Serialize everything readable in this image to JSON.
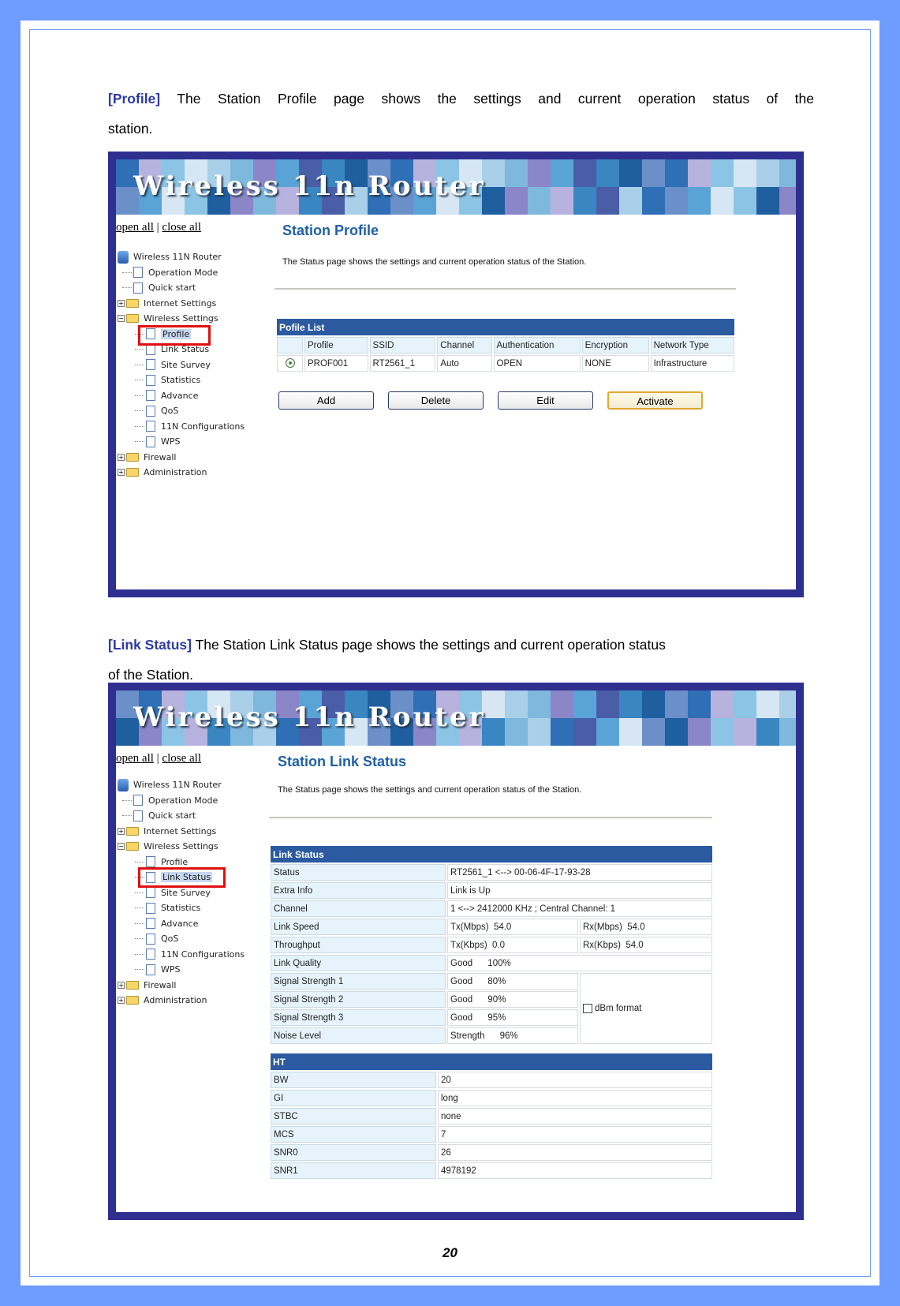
{
  "page": {
    "profile_para": {
      "keyword": "[Profile]",
      "text": " The Station Profile page shows the settings and current operation status of the",
      "text2": "station."
    },
    "link_para": {
      "keyword": "[Link Status]",
      "text": " The Station Link Status page shows the settings and current operation status",
      "text2": "of the Station."
    },
    "page_number": "20",
    "border_color": "#6f9cff",
    "frame_color": "#2f2f8f"
  },
  "common": {
    "banner_title": "Wireless 11n Router",
    "open_all": "open all",
    "separator": "|",
    "close_all": "close all",
    "tree": [
      {
        "label": "Wireless 11N Router",
        "type": "root"
      },
      {
        "label": "Operation Mode",
        "type": "page",
        "level": 1
      },
      {
        "label": "Quick start",
        "type": "page",
        "level": 1
      },
      {
        "label": "Internet Settings",
        "type": "folder-collapsed",
        "level": 1
      },
      {
        "label": "Wireless Settings",
        "type": "folder-expanded",
        "level": 1
      },
      {
        "label": "Profile",
        "type": "page",
        "level": 2
      },
      {
        "label": "Link Status",
        "type": "page",
        "level": 2
      },
      {
        "label": "Site Survey",
        "type": "page",
        "level": 2
      },
      {
        "label": "Statistics",
        "type": "page",
        "level": 2
      },
      {
        "label": "Advance",
        "type": "page",
        "level": 2
      },
      {
        "label": "QoS",
        "type": "page",
        "level": 2
      },
      {
        "label": "11N Configurations",
        "type": "page",
        "level": 2
      },
      {
        "label": "WPS",
        "type": "page",
        "level": 2
      },
      {
        "label": "Firewall",
        "type": "folder-collapsed",
        "level": 1
      },
      {
        "label": "Administration",
        "type": "folder-collapsed",
        "level": 1
      }
    ],
    "highlight_color": "#e01010",
    "header_color": "#2b5aa0"
  },
  "profile_shot": {
    "selected_item": "Profile",
    "title": "Station Profile",
    "description": "The Status page shows the settings and current operation status of the Station.",
    "list_title": "Pofile List",
    "columns": [
      "",
      "Profile",
      "SSID",
      "Channel",
      "Authentication",
      "Encryption",
      "Network Type"
    ],
    "rows": [
      {
        "selected": true,
        "profile": "PROF001",
        "ssid": "RT2561_1",
        "channel": "Auto",
        "auth": "OPEN",
        "enc": "NONE",
        "type": "Infrastructure"
      }
    ],
    "buttons": {
      "add": "Add",
      "delete": "Delete",
      "edit": "Edit",
      "activate": "Activate"
    }
  },
  "link_shot": {
    "selected_item": "Link Status",
    "title": "Station Link Status",
    "description": "The Status page shows the settings and current operation status of the Station.",
    "link_title": "Link Status",
    "status": {
      "label": "Status",
      "value": "RT2561_1 <--> 00-06-4F-17-93-28"
    },
    "extra": {
      "label": "Extra Info",
      "value": "Link is Up"
    },
    "channel": {
      "label": "Channel",
      "value": "1 <--> 2412000 KHz ; Central Channel: 1"
    },
    "speed": {
      "label": "Link Speed",
      "tx": "Tx(Mbps)  54.0",
      "rx": "Rx(Mbps)  54.0"
    },
    "throughput": {
      "label": "Throughput",
      "tx": "Tx(Kbps)  0.0",
      "rx": "Rx(Kbps)  54.0"
    },
    "quality": {
      "label": "Link Quality",
      "value": "Good      100%"
    },
    "signal1": {
      "label": "Signal Strength 1",
      "value": "Good      80%"
    },
    "signal2": {
      "label": "Signal Strength 2",
      "value": "Good      90%"
    },
    "signal3": {
      "label": "Signal Strength 3",
      "value": "Good      95%"
    },
    "noise": {
      "label": "Noise Level",
      "value": "Strength      96%"
    },
    "dbm_label": "dBm format",
    "dbm_checked": false,
    "ht_title": "HT",
    "ht_rows": [
      {
        "label": "BW",
        "value": "20"
      },
      {
        "label": "GI",
        "value": "long"
      },
      {
        "label": "STBC",
        "value": "none"
      },
      {
        "label": "MCS",
        "value": "7"
      },
      {
        "label": "SNR0",
        "value": "26"
      },
      {
        "label": "SNR1",
        "value": "4978192"
      }
    ]
  }
}
